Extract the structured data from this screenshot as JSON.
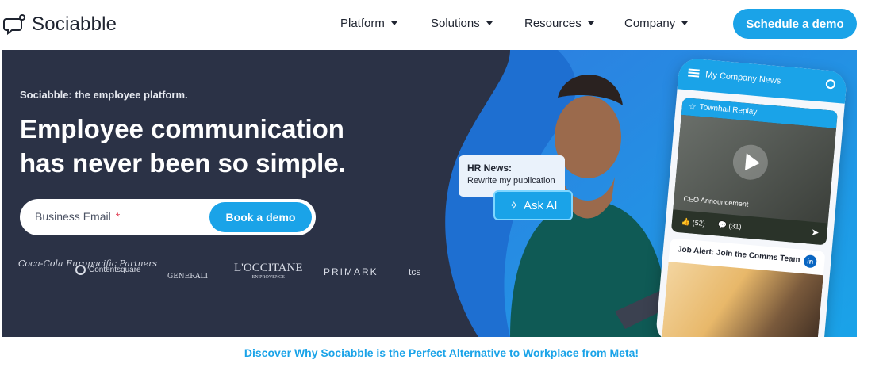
{
  "header": {
    "brand": "Sociabble",
    "nav": [
      {
        "label": "Platform"
      },
      {
        "label": "Solutions"
      },
      {
        "label": "Resources"
      },
      {
        "label": "Company"
      }
    ],
    "cta_label": "Schedule a demo"
  },
  "hero": {
    "eyebrow": "Sociabble: the employee platform.",
    "headline_line1": "Employee communication",
    "headline_line2": "has never been so simple.",
    "email_placeholder": "Business Email",
    "required_marker": "*",
    "book_label": "Book a demo",
    "brands": [
      "Coca-Cola Europacific Partners",
      "Contentsquare",
      "GENERALI",
      "L'OCCITANE",
      "EN PROVENCE",
      "PRIMARK",
      "tcs"
    ]
  },
  "phone": {
    "title": "My Company News",
    "card1_header": "Townhall Replay",
    "video_label": "CEO Announcement",
    "likes": "(52)",
    "comments": "(31)",
    "card2_title": "Job Alert: Join the Comms Team",
    "card2_badge": "in"
  },
  "hr_popup": {
    "title": "HR News:",
    "subtitle": "Rewrite my publication",
    "ask_ai_label": "Ask AI"
  },
  "footer_link": "Discover Why Sociabble is the Perfect Alternative to Workplace from Meta!",
  "colors": {
    "accent": "#1aa3e8",
    "hero_dark": "#2b3246",
    "hero_blue": "#1aa3e8"
  }
}
